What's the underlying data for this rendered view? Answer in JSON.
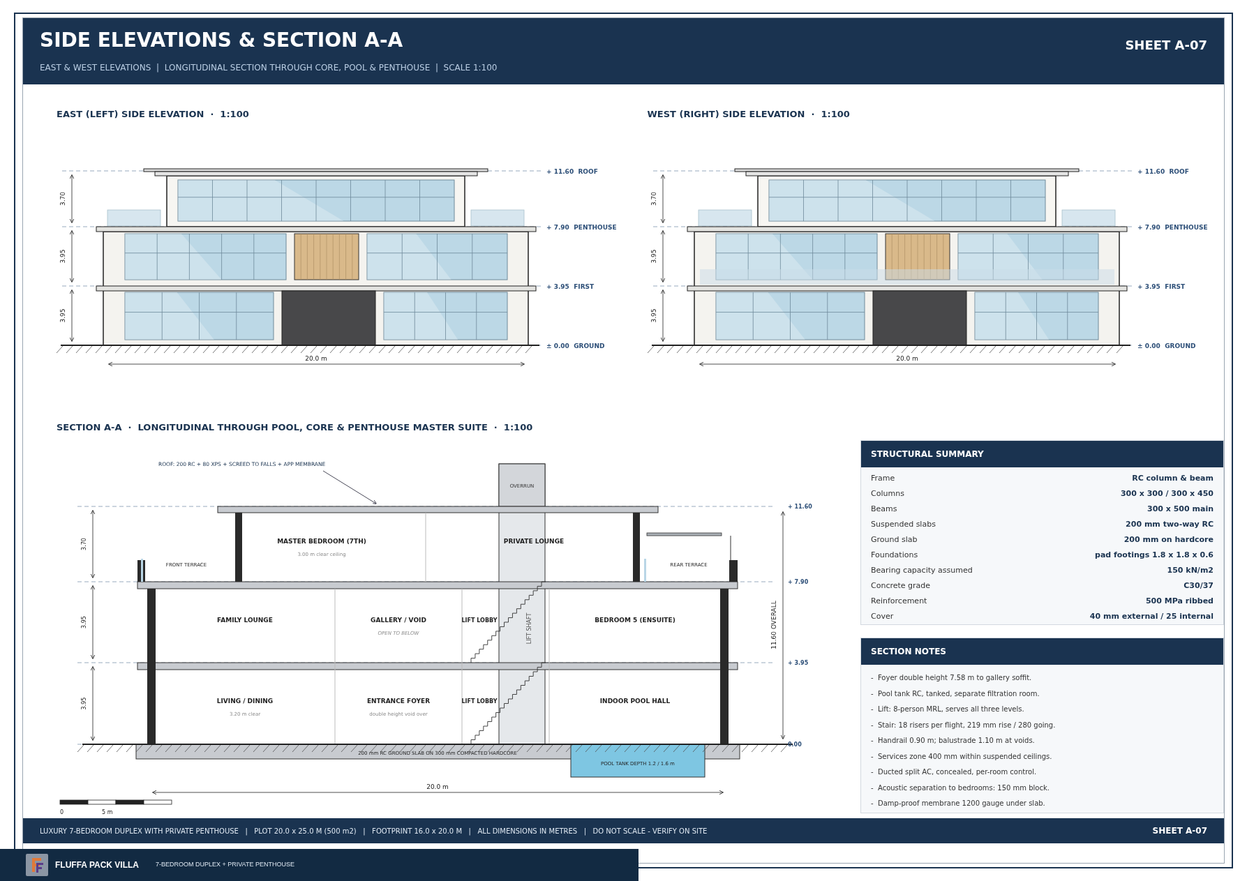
{
  "sheet": {
    "title": "SIDE ELEVATIONS & SECTION A-A",
    "subtitle": "EAST & WEST ELEVATIONS  |  LONGITUDINAL SECTION THROUGH CORE, POOL & PENTHOUSE  |  SCALE 1:100",
    "sheet_no": "SHEET A-07"
  },
  "elevations": [
    {
      "title": "EAST (LEFT) SIDE ELEVATION  ·  1:100",
      "levels": [
        "+ 11.60  ROOF",
        "+ 7.90  PENTHOUSE",
        "+ 3.95  FIRST",
        "± 0.00  GROUND"
      ],
      "heights": [
        "3.70",
        "3.95",
        "3.95"
      ],
      "width": "20.0 m"
    },
    {
      "title": "WEST (RIGHT) SIDE ELEVATION  ·  1:100",
      "levels": [
        "+ 11.60  ROOF",
        "+ 7.90  PENTHOUSE",
        "+ 3.95  FIRST",
        "± 0.00  GROUND"
      ],
      "heights": [
        "3.70",
        "3.95",
        "3.95"
      ],
      "width": "20.0 m"
    }
  ],
  "section": {
    "title": "SECTION A-A  ·  LONGITUDINAL THROUGH POOL, CORE & PENTHOUSE MASTER SUITE  ·  1:100",
    "roof_note": "ROOF: 200 RC + 80 XPS + SCREED TO FALLS + APP MEMBRANE",
    "overrun": "OVERRUN",
    "shaft": "LIFT SHAFT",
    "levels": [
      "+ 11.60",
      "+ 7.90",
      "+ 3.95",
      "0.00"
    ],
    "heights": [
      "3.70",
      "3.95",
      "3.95"
    ],
    "overall": "11.60 OVERALL",
    "width": "20.0 m",
    "slab_note": "200 mm RC GROUND SLAB ON 300 mm COMPACTED HARDCORE",
    "pool_note": "POOL TANK  DEPTH 1.2 / 1.6 m",
    "floors": [
      {
        "rooms": [
          {
            "kind": "terrace",
            "name": "FRONT TERRACE"
          },
          {
            "kind": "room",
            "name": "MASTER BEDROOM (7TH)",
            "note": "3.00 m clear ceiling"
          },
          {
            "kind": "room",
            "name": "PRIVATE LOUNGE"
          },
          {
            "kind": "terrace",
            "name": "REAR TERRACE"
          }
        ]
      },
      {
        "rooms": [
          {
            "kind": "room",
            "name": "FAMILY LOUNGE"
          },
          {
            "kind": "room",
            "name": "GALLERY / VOID",
            "note": "OPEN TO BELOW",
            "italic": true
          },
          {
            "kind": "room",
            "name": "LIFT LOBBY"
          },
          {
            "kind": "room",
            "name": "BEDROOM 5 (ENSUITE)"
          }
        ]
      },
      {
        "rooms": [
          {
            "kind": "room",
            "name": "LIVING / DINING",
            "note": "3.20 m clear"
          },
          {
            "kind": "room",
            "name": "ENTRANCE FOYER",
            "note": "double height void over"
          },
          {
            "kind": "room",
            "name": "LIFT LOBBY"
          },
          {
            "kind": "room",
            "name": "INDOOR POOL HALL"
          }
        ]
      }
    ],
    "scale": [
      "0",
      "5 m"
    ]
  },
  "structural_summary": {
    "title": "STRUCTURAL SUMMARY",
    "rows": [
      {
        "label": "Frame",
        "value": "RC column & beam"
      },
      {
        "label": "Columns",
        "value": "300 x 300 / 300 x 450"
      },
      {
        "label": "Beams",
        "value": "300 x 500 main"
      },
      {
        "label": "Suspended slabs",
        "value": "200 mm two-way RC"
      },
      {
        "label": "Ground slab",
        "value": "200 mm on hardcore"
      },
      {
        "label": "Foundations",
        "value": "pad footings 1.8 x 1.8 x 0.6"
      },
      {
        "label": "Bearing capacity assumed",
        "value": "150 kN/m2"
      },
      {
        "label": "Concrete grade",
        "value": "C30/37"
      },
      {
        "label": "Reinforcement",
        "value": "500 MPa ribbed"
      },
      {
        "label": "Cover",
        "value": "40 mm external / 25 internal"
      }
    ]
  },
  "section_notes": {
    "title": "SECTION NOTES",
    "items": [
      "-  Foyer double height 7.58 m to gallery soffit.",
      "-  Pool tank RC, tanked, separate filtration room.",
      "-  Lift: 8-person MRL, serves all three levels.",
      "-  Stair: 18 risers per flight, 219 mm rise / 280 going.",
      "-  Handrail 0.90 m; balustrade 1.10 m at voids.",
      "-  Services zone 400 mm within suspended ceilings.",
      "-  Ducted split AC, concealed, per-room control.",
      "-  Acoustic separation to bedrooms: 150 mm block.",
      "-  Damp-proof membrane 1200 gauge under slab."
    ]
  },
  "footer": {
    "text": "LUXURY 7-BEDROOM DUPLEX WITH PRIVATE PENTHOUSE   |   PLOT 20.0 x 25.0 M (500 m2)   |   FOOTPRINT 16.0 x 20.0 M   |   ALL DIMENSIONS IN METRES   |   DO NOT SCALE - VERIFY ON SITE",
    "sheet_no": "SHEET A-07"
  },
  "brand": {
    "name": "FLUFFA PACK VILLA",
    "tagline": "7-BEDROOM DUPLEX + PRIVATE PENTHOUSE"
  }
}
